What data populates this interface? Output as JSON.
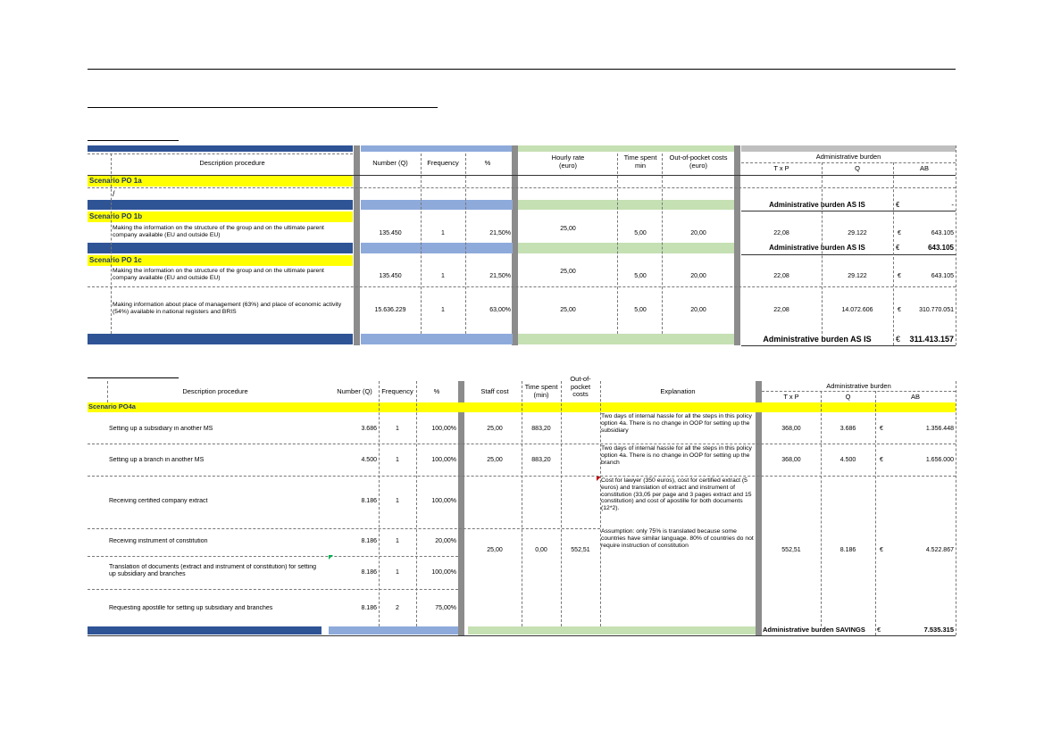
{
  "table1": {
    "headers": {
      "description": "Description procedure",
      "number": "Number (Q)",
      "frequency": "Frequency",
      "percent": "%",
      "hourly_rate": "Hourly rate\n(euro)",
      "time_spent": "Time spent\nmin",
      "oop": "Out-of-pocket costs\n(euro)",
      "admin_burden": "Administrative burden",
      "txp": "T x P",
      "q": "Q",
      "ab": "AB"
    },
    "scenario_1a": {
      "label": "Scenario PO 1a",
      "mark": "/",
      "total_label": "Administrative burden AS IS",
      "currency": "€",
      "total_value": "-"
    },
    "scenario_1b": {
      "label": "Scenario PO 1b",
      "row": {
        "description": "Making the information on the structure of the group and on the ultimate parent company available (EU and outside EU)",
        "number": "135.450",
        "frequency": "1",
        "percent": "21,50%",
        "hourly_rate": "25,00",
        "time_spent": "5,00",
        "oop": "20,00",
        "txp": "22,08",
        "q": "29.122",
        "currency": "€",
        "ab": "643.105"
      },
      "total_label": "Administrative burden AS IS",
      "currency": "€",
      "total_value": "643.105"
    },
    "scenario_1c": {
      "label": "Scenario PO 1c",
      "rows": [
        {
          "description": "Making the information on the structure of the group and on the ultimate parent company available (EU and outside EU)",
          "number": "135.450",
          "frequency": "1",
          "percent": "21,50%",
          "hourly_rate": "25,00",
          "time_spent": "5,00",
          "oop": "20,00",
          "txp": "22,08",
          "q": "29.122",
          "currency": "€",
          "ab": "643.105"
        },
        {
          "description": "Making information about place of management (63%) and place of economic activity (54%) available in national registers and BRIS",
          "number": "15.636.229",
          "frequency": "1",
          "percent": "63,00%",
          "hourly_rate": "25,00",
          "time_spent": "5,00",
          "oop": "20,00",
          "txp": "22,08",
          "q": "14.072.606",
          "currency": "€",
          "ab": "310.770.051"
        }
      ],
      "total_label": "Administrative burden AS IS",
      "currency": "€",
      "total_value": "311.413.157"
    }
  },
  "table2": {
    "headers": {
      "description": "Description procedure",
      "number": "Number (Q)",
      "frequency": "Frequency",
      "percent": "%",
      "staff_cost": "Staff cost",
      "time_spent": "Time spent\n(min)",
      "oop": "Out-of-\npocket\ncosts",
      "explanation": "Explanation",
      "admin_burden": "Administrative burden",
      "txp": "T x P",
      "q": "Q",
      "ab": "AB"
    },
    "scenario_label": "Scenario PO4a",
    "rows": [
      {
        "description": "Setting up a subsidiary in another MS",
        "number": "3.686",
        "frequency": "1",
        "percent": "100,00%",
        "staff_cost": "25,00",
        "time_spent": "883,20",
        "explanation": "Two days of internal hassle for all the steps in this policy option 4a. There is no change in OOP for setting up the subsidiary",
        "txp": "368,00",
        "q": "3.686",
        "currency": "€",
        "ab": "1.356.448"
      },
      {
        "description": "Setting up a branch in another MS",
        "number": "4.500",
        "frequency": "1",
        "percent": "100,00%",
        "staff_cost": "25,00",
        "time_spent": "883,20",
        "explanation": "Two days of internal hassle for all the steps in this policy option 4a. There is no change in OOP for setting up the branch",
        "txp": "368,00",
        "q": "4.500",
        "currency": "€",
        "ab": "1.656.000"
      },
      {
        "description": "Receiving certified company extract",
        "number": "8.186",
        "frequency": "1",
        "percent": "100,00%"
      },
      {
        "description": "Receiving instrument of constitution",
        "number": "8.186",
        "frequency": "1",
        "percent": "20,00%"
      },
      {
        "description": "Translation of documents (extract and instrument of constitution) for setting up subsidiary and branches",
        "number": "8.186",
        "frequency": "1",
        "percent": "100,00%"
      },
      {
        "description": "Requesting apostille for setting up subsidiary and branches",
        "number": "8.186",
        "frequency": "2",
        "percent": "75,00%"
      }
    ],
    "merged": {
      "staff_cost": "25,00",
      "time_spent": "0,00",
      "oop": "552,51",
      "explanation_cost": "Cost for lawyer (350 euros), cost for certified extract (5 euros) and translation of extract and instrument of constitution (33,05 per page and 3 pages extract and 15 constitution) and cost of apostille for both documents (12*2).",
      "explanation_assumption": "Assumption: only 75% is translated because some countries have similar language. 80% of countries do not require instruction of constitution",
      "txp": "552,51",
      "q": "8.186",
      "currency": "€",
      "ab": "4.522.867"
    },
    "total_label": "Administrative burden SAVINGS",
    "currency": "€",
    "total_value": "7.535.315"
  },
  "colors": {
    "dark_blue": "#2f5496",
    "light_blue": "#8eaadb",
    "light_green": "#c5e0b3",
    "yellow": "#ffff00",
    "grey_separator": "#8c8c8c"
  }
}
